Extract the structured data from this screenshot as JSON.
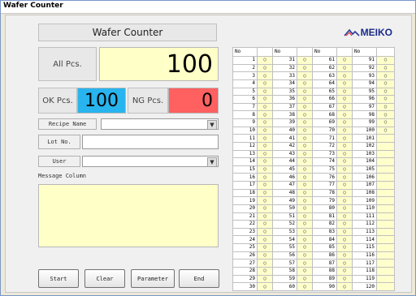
{
  "window": {
    "title": "Wafer Counter"
  },
  "header": {
    "title": "Wafer Counter",
    "logo": "MEIKO"
  },
  "counts": {
    "all_label": "All Pcs.",
    "all_value": "100",
    "ok_label": "OK Pcs.",
    "ok_value": "100",
    "ng_label": "NG Pcs.",
    "ng_value": "0"
  },
  "form": {
    "recipe_label": "Recipe Name",
    "recipe_value": "",
    "lot_label": "Lot No.",
    "lot_value": "",
    "user_label": "User",
    "user_value": ""
  },
  "message": {
    "label": "Message Column",
    "text": ""
  },
  "buttons": {
    "start": "Start",
    "clear": "Clear",
    "parameter": "Parameter",
    "end": "End"
  },
  "table": {
    "header": "No",
    "columns": [
      {
        "numbers": [
          "1",
          "2",
          "3",
          "4",
          "5",
          "6",
          "7",
          "8",
          "9",
          "10",
          "11",
          "12",
          "13",
          "14",
          "15",
          "16",
          "17",
          "18",
          "19",
          "20",
          "21",
          "22",
          "23",
          "24",
          "25",
          "26",
          "27",
          "28",
          "29",
          "30"
        ],
        "marks": [
          "○",
          "○",
          "○",
          "○",
          "○",
          "○",
          "○",
          "○",
          "○",
          "○",
          "○",
          "○",
          "○",
          "○",
          "○",
          "○",
          "○",
          "○",
          "○",
          "○",
          "○",
          "○",
          "○",
          "○",
          "○",
          "○",
          "○",
          "○",
          "○",
          "○"
        ]
      },
      {
        "numbers": [
          "31",
          "32",
          "33",
          "34",
          "35",
          "36",
          "37",
          "38",
          "39",
          "40",
          "41",
          "42",
          "43",
          "44",
          "45",
          "46",
          "47",
          "48",
          "49",
          "50",
          "51",
          "52",
          "53",
          "54",
          "55",
          "56",
          "57",
          "58",
          "59",
          "60"
        ],
        "marks": [
          "○",
          "○",
          "○",
          "○",
          "○",
          "○",
          "○",
          "○",
          "○",
          "○",
          "○",
          "○",
          "○",
          "○",
          "○",
          "○",
          "○",
          "○",
          "○",
          "○",
          "○",
          "○",
          "○",
          "○",
          "○",
          "○",
          "○",
          "○",
          "○",
          "○"
        ]
      },
      {
        "numbers": [
          "61",
          "62",
          "63",
          "64",
          "65",
          "66",
          "67",
          "68",
          "69",
          "70",
          "71",
          "72",
          "73",
          "74",
          "75",
          "76",
          "77",
          "78",
          "79",
          "80",
          "81",
          "82",
          "83",
          "84",
          "85",
          "86",
          "87",
          "88",
          "89",
          "90"
        ],
        "marks": [
          "○",
          "○",
          "○",
          "○",
          "○",
          "○",
          "○",
          "○",
          "○",
          "○",
          "○",
          "○",
          "○",
          "○",
          "○",
          "○",
          "○",
          "○",
          "○",
          "○",
          "○",
          "○",
          "○",
          "○",
          "○",
          "○",
          "○",
          "○",
          "○",
          "○"
        ]
      },
      {
        "numbers": [
          "91",
          "92",
          "93",
          "94",
          "95",
          "96",
          "97",
          "98",
          "99",
          "100",
          "101",
          "102",
          "103",
          "104",
          "105",
          "106",
          "107",
          "108",
          "109",
          "110",
          "111",
          "112",
          "113",
          "114",
          "115",
          "116",
          "117",
          "118",
          "119",
          "120"
        ],
        "marks": [
          "○",
          "○",
          "○",
          "○",
          "○",
          "○",
          "○",
          "○",
          "○",
          "○",
          "",
          "",
          "",
          "",
          "",
          "",
          "",
          "",
          "",
          "",
          "",
          "",
          "",
          "",
          "",
          "",
          "",
          "",
          "",
          ""
        ]
      }
    ]
  },
  "colors": {
    "all_bg": "#ffffc8",
    "ok_bg": "#28b4ee",
    "ng_bg": "#ff6060",
    "cell_bg": "#ffffcc"
  }
}
